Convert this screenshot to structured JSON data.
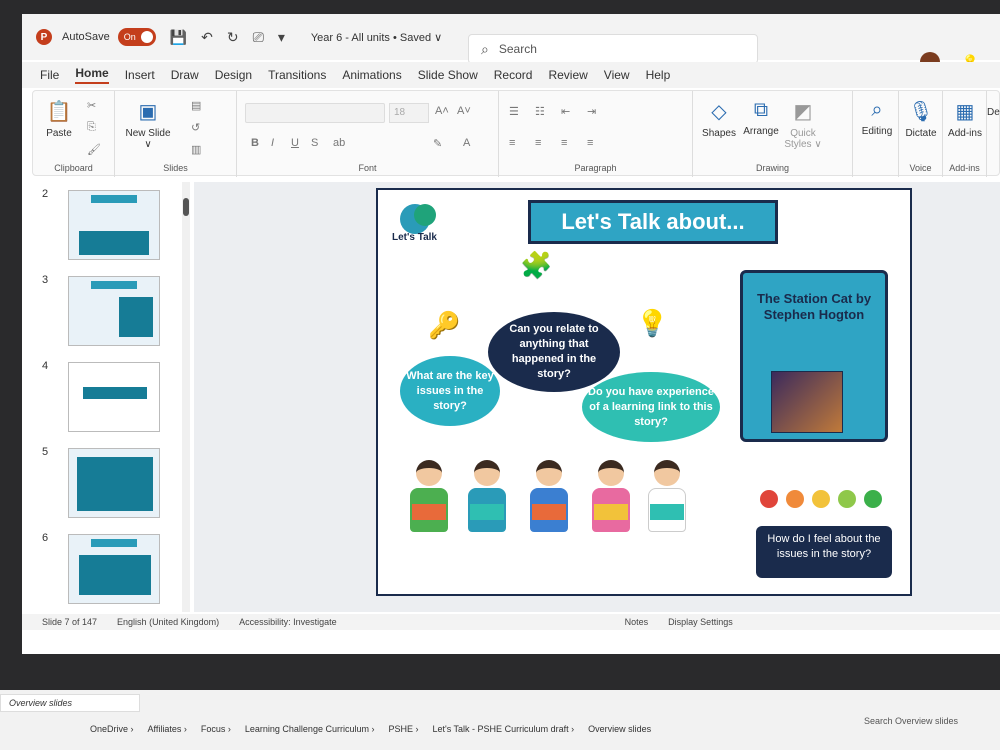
{
  "titlebar": {
    "app_letter": "P",
    "autosave_label": "AutoSave",
    "toggle_label": "On",
    "doc_title": "Year 6 - All units • Saved ∨",
    "search_placeholder": "Search"
  },
  "tabs": [
    "File",
    "Home",
    "Insert",
    "Draw",
    "Design",
    "Transitions",
    "Animations",
    "Slide Show",
    "Record",
    "Review",
    "View",
    "Help"
  ],
  "ribbon": {
    "paste": "Paste",
    "new_slide": "New Slide ∨",
    "font_size": "18",
    "shapes": "Shapes",
    "arrange": "Arrange",
    "quick_styles": "Quick Styles ∨",
    "editing": "Editing",
    "dictate": "Dictate",
    "addins": "Add-ins",
    "design": "Desi",
    "record": "Record",
    "groups": {
      "clipboard": "Clipboard",
      "slides": "Slides",
      "font": "Font",
      "paragraph": "Paragraph",
      "drawing": "Drawing",
      "voice": "Voice",
      "addins": "Add-ins"
    }
  },
  "thumbnails": [
    "2",
    "3",
    "4",
    "5",
    "6"
  ],
  "slide": {
    "logo_text": "Let's Talk",
    "title": "Let's Talk about...",
    "bubble_relate": "Can you relate to anything that happened in the story?",
    "bubble_issues": "What are the key issues in the story?",
    "bubble_experience": "Do you have experience of a learning link to this story?",
    "book_title": "The Station Cat by Stephen Hogton",
    "feel": "How do I feel about the issues in the story?",
    "face_colors": [
      "#e0453a",
      "#f08a3a",
      "#f2c23a",
      "#8fc84a",
      "#3bb04a"
    ]
  },
  "status": {
    "slide_count": "Slide 7 of 147",
    "language": "English (United Kingdom)",
    "accessibility": "Accessibility: Investigate",
    "notes": "Notes",
    "display": "Display Settings"
  },
  "explorer": {
    "tab": "Overview slides",
    "breadcrumb": [
      "OneDrive",
      "Affiliates",
      "Focus",
      "Learning Challenge Curriculum",
      "PSHE",
      "Let's Talk - PSHE Curriculum draft",
      "Overview slides"
    ],
    "search": "Search Overview slides"
  }
}
